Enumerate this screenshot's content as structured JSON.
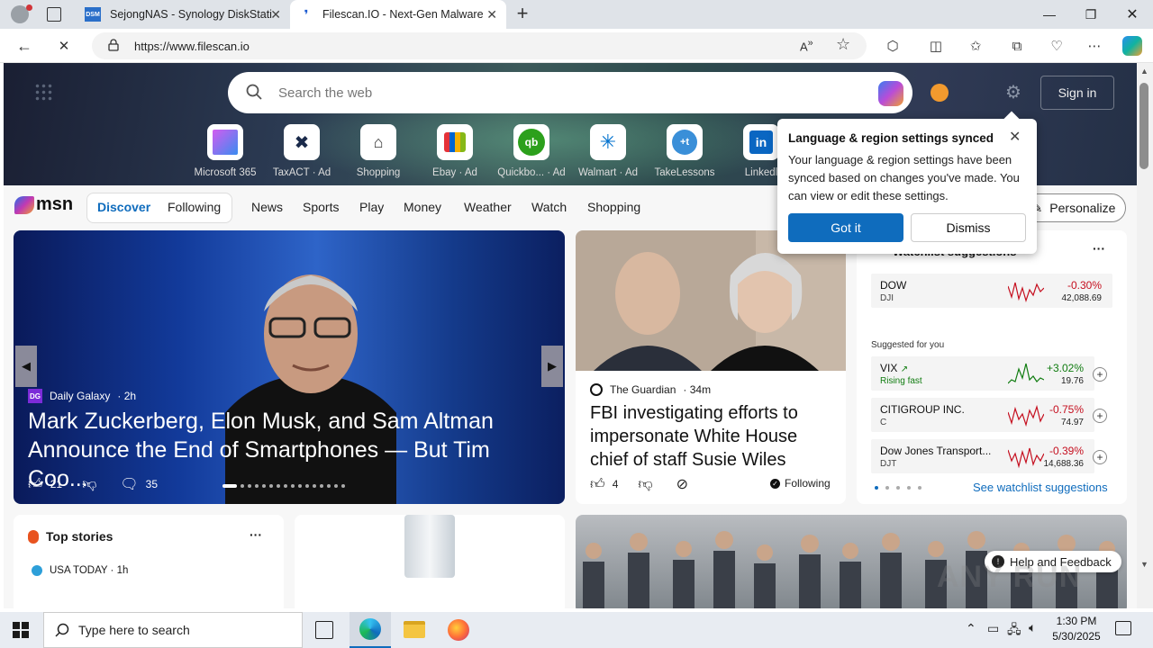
{
  "browser": {
    "tabs": [
      {
        "label": "SejongNAS - Synology DiskStatio",
        "favicon": "DSM"
      },
      {
        "label": "Filescan.IO - Next-Gen Malware A",
        "favicon": "filescan-icon"
      }
    ],
    "url": "https://www.filescan.io"
  },
  "search": {
    "placeholder": "Search the web"
  },
  "header": {
    "signin": "Sign in"
  },
  "quicklinks": [
    {
      "label": "Microsoft 365"
    },
    {
      "label": "TaxACT",
      "ad": "Ad"
    },
    {
      "label": "Shopping"
    },
    {
      "label": "Ebay",
      "ad": "Ad"
    },
    {
      "label": "Quickbo...",
      "ad": "Ad"
    },
    {
      "label": "Walmart",
      "ad": "Ad"
    },
    {
      "label": "TakeLessons"
    },
    {
      "label": "Linkedl"
    }
  ],
  "msn": {
    "logo": "msn",
    "tabs": {
      "discover": "Discover",
      "following": "Following"
    },
    "nav": [
      "News",
      "Sports",
      "Play",
      "Money",
      "Weather",
      "Watch",
      "Shopping"
    ],
    "personalize": "Personalize"
  },
  "popup": {
    "title": "Language & region settings synced",
    "body": "Your language & region settings have been synced based on changes you've made. You can view or edit these settings.",
    "got_it": "Got it",
    "dismiss": "Dismiss"
  },
  "featured": {
    "source": "Daily Galaxy",
    "source_badge": "DG",
    "time": "· 2h",
    "title": "Mark Zuckerberg, Elon Musk, and Sam Altman Announce the End of Smartphones — But Tim Coo...",
    "likes": "21",
    "comments": "35"
  },
  "guardian": {
    "source": "The Guardian",
    "time": "· 34m",
    "title": "FBI investigating efforts to impersonate White House chief of staff Susie Wiles",
    "likes": "4",
    "following": "Following"
  },
  "watchlist": {
    "title": "Watchlist suggestions",
    "suggested": "Suggested for you",
    "see_more": "See watchlist suggestions",
    "items": [
      {
        "name": "DOW",
        "symbol": "DJI",
        "change": "-0.30%",
        "price": "42,088.69"
      },
      {
        "name": "VIX",
        "symbol": "Rising fast",
        "change": "+3.02%",
        "price": "19.76"
      },
      {
        "name": "CITIGROUP INC.",
        "symbol": "C",
        "change": "-0.75%",
        "price": "74.97"
      },
      {
        "name": "Dow Jones Transport...",
        "symbol": "DJT",
        "change": "-0.39%",
        "price": "14,688.36"
      }
    ]
  },
  "top_stories": {
    "title": "Top stories",
    "source": "USA TODAY · 1h"
  },
  "help": "Help and Feedback",
  "taskbar": {
    "search_placeholder": "Type here to search",
    "time": "1:30 PM",
    "date": "5/30/2025"
  },
  "watermark": "ANY RUN",
  "colors": {
    "accent": "#0f6cbd",
    "negative": "#c50f1f",
    "positive": "#107c10"
  }
}
